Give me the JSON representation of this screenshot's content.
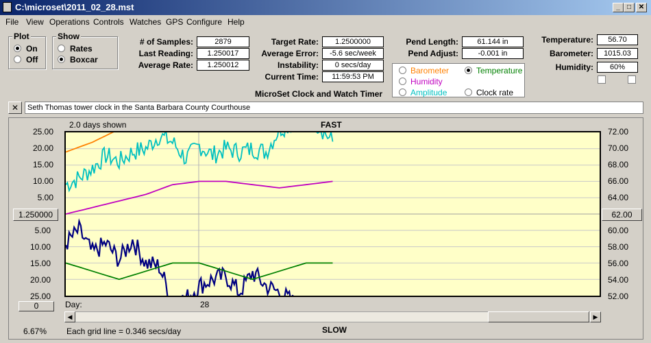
{
  "window": {
    "title": "C:\\microset\\2011_02_28.mst"
  },
  "menu": [
    "File",
    "View",
    "Operations",
    "Controls",
    "Watches",
    "GPS",
    "Configure",
    "Help"
  ],
  "plot": {
    "label": "Plot",
    "on": "On",
    "off": "Off",
    "selected": "On"
  },
  "show": {
    "label": "Show",
    "rates": "Rates",
    "boxcar": "Boxcar",
    "selected": "Boxcar"
  },
  "stats": {
    "samples_label": "# of Samples:",
    "samples": "2879",
    "last_label": "Last Reading:",
    "last": "1.250017",
    "avg_label": "Average Rate:",
    "avg": "1.250012",
    "target_label": "Target Rate:",
    "target": "1.2500000",
    "avgerr_label": "Average Error:",
    "avgerr": "-5.6 sec/week",
    "instab_label": "Instability:",
    "instab": "0 secs/day",
    "time_label": "Current Time:",
    "time": "11:59:53 PM",
    "pendlen_label": "Pend Length:",
    "pendlen": "61.144 in",
    "pendadj_label": "Pend Adjust:",
    "pendadj": "-0.001 in",
    "temp_label": "Temperature:",
    "temp": "56.70",
    "baro_label": "Barometer:",
    "baro": "1015.03",
    "hum_label": "Humidity:",
    "hum": "60%"
  },
  "overlay": {
    "barometer": "Barometer",
    "temperature": "Temperature",
    "humidity": "Humidity",
    "amplitude": "Amplitude",
    "clockrate": "Clock rate",
    "selected": "Temperature",
    "colors": {
      "barometer": "#ff8000",
      "temperature": "#008000",
      "humidity": "#c000c0",
      "amplitude": "#00c0c0",
      "clockrate": "#000000"
    }
  },
  "app_caption": "MicroSet Clock and Watch Timer",
  "description": "Seth Thomas tower clock in the Santa Barbara County Courthouse",
  "close_glyph": "✕",
  "chart_data": {
    "type": "line",
    "days_shown": "2.0 days shown",
    "top_label": "FAST",
    "bottom_label": "SLOW",
    "center_rate": "1.250000",
    "center_temp": "62.00",
    "zero_btn": "0",
    "day_label": "Day:",
    "day_tick": "28",
    "grid_note": "Each grid line = 0.346 secs/day",
    "percent": "6.67%",
    "left_ticks_top": [
      "25.00",
      "20.00",
      "15.00",
      "10.00",
      "5.00"
    ],
    "left_ticks_bottom": [
      "5.00",
      "10.00",
      "15.00",
      "20.00",
      "25.00"
    ],
    "right_ticks": [
      "72.00",
      "70.00",
      "68.00",
      "66.00",
      "64.00",
      "60.00",
      "58.00",
      "56.00",
      "54.00",
      "52.00"
    ],
    "ylim_rate": [
      -25,
      25
    ],
    "ylim_temp": [
      52,
      72
    ],
    "series": [
      {
        "name": "Barometer",
        "color": "#ff8000",
        "x": [
          0,
          0.1,
          0.2,
          0.3,
          0.4,
          0.5,
          0.55,
          0.65,
          0.75,
          0.85,
          0.9,
          0.95,
          1.0
        ],
        "y": [
          19,
          22,
          26,
          29,
          33,
          35,
          34,
          34,
          33,
          29,
          32,
          29,
          30
        ]
      },
      {
        "name": "Amplitude",
        "color": "#00c0c0",
        "x": [
          0,
          0.05,
          0.1,
          0.15,
          0.2,
          0.25,
          0.3,
          0.35,
          0.4,
          0.45,
          0.5,
          0.55,
          0.6,
          0.65,
          0.7,
          0.75,
          0.8,
          0.85,
          0.9,
          0.95,
          1.0
        ],
        "y": [
          9,
          11,
          14,
          18,
          16,
          19,
          20,
          24,
          22,
          17,
          21,
          18,
          20,
          19,
          20,
          19,
          26,
          28,
          30,
          27,
          22
        ]
      },
      {
        "name": "Humidity",
        "color": "#c000c0",
        "x": [
          0,
          0.1,
          0.2,
          0.3,
          0.4,
          0.5,
          0.6,
          0.7,
          0.8,
          0.9,
          1.0
        ],
        "y": [
          0,
          2,
          4,
          6,
          9,
          10,
          10,
          9,
          8,
          9,
          10
        ]
      },
      {
        "name": "Clock rate",
        "color": "#000080",
        "x": [
          0,
          0.05,
          0.1,
          0.15,
          0.2,
          0.25,
          0.3,
          0.35,
          0.4,
          0.45,
          0.5,
          0.55,
          0.6,
          0.65,
          0.7,
          0.75,
          0.8,
          0.85,
          0.9,
          0.95,
          1.0
        ],
        "y": [
          -9,
          -5,
          -12,
          -9,
          -14,
          -8,
          -15,
          -16,
          -27,
          -26,
          -22,
          -20,
          -19,
          -24,
          -18,
          -22,
          -24,
          -27,
          -34,
          -33,
          -29
        ]
      },
      {
        "name": "Temperature",
        "color": "#008000",
        "x": [
          0,
          0.1,
          0.2,
          0.3,
          0.4,
          0.5,
          0.6,
          0.7,
          0.8,
          0.9,
          1.0
        ],
        "y": [
          56,
          55,
          54,
          55,
          56,
          56,
          55,
          54,
          55,
          56,
          56
        ]
      }
    ]
  }
}
